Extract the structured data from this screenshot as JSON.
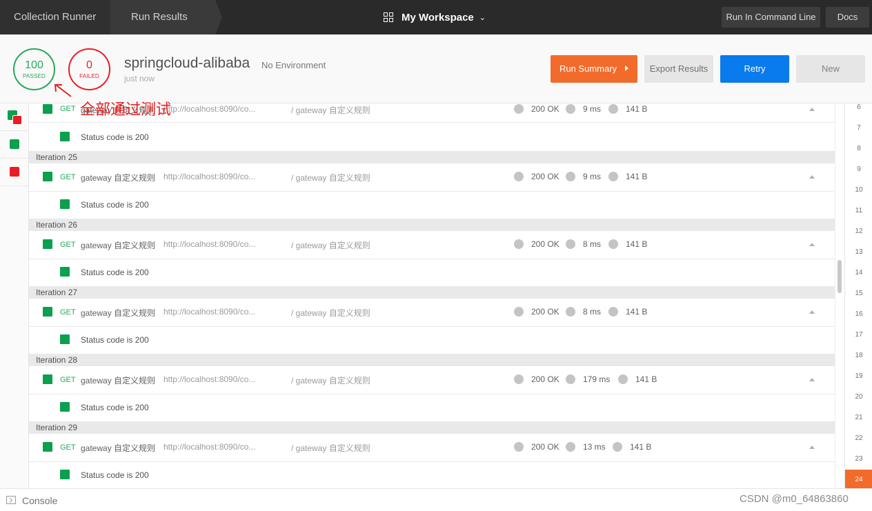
{
  "topbar": {
    "crumb1": "Collection Runner",
    "crumb2": "Run Results",
    "workspace": "My Workspace",
    "cmd_button": "Run In Command Line",
    "docs_button": "Docs"
  },
  "summary": {
    "passed_count": "100",
    "passed_label": "PASSED",
    "failed_count": "0",
    "failed_label": "FAILED",
    "collection_name": "springcloud-alibaba",
    "environment": "No Environment",
    "time": "just now",
    "buttons": {
      "run_summary": "Run Summary",
      "export": "Export Results",
      "retry": "Retry",
      "new": "New"
    }
  },
  "annotation": "全部通过测试",
  "rail": [
    {
      "status": "mixed"
    },
    {
      "status": "pass"
    },
    {
      "status": "fail"
    }
  ],
  "partial_row": {
    "method": "GET",
    "name": "gateway 自定义规则",
    "url": "http://localhost:8090/co...",
    "path": "/ gateway 自定义规则",
    "status": "200 OK",
    "time": "9 ms",
    "size": "141 B",
    "test": "Status code is 200"
  },
  "iterations": [
    {
      "label": "Iteration 25",
      "method": "GET",
      "name": "gateway 自定义规则",
      "url": "http://localhost:8090/co...",
      "path": "/ gateway 自定义规则",
      "status": "200 OK",
      "time": "9 ms",
      "size": "141 B",
      "test": "Status code is 200"
    },
    {
      "label": "Iteration 26",
      "method": "GET",
      "name": "gateway 自定义规则",
      "url": "http://localhost:8090/co...",
      "path": "/ gateway 自定义规则",
      "status": "200 OK",
      "time": "8 ms",
      "size": "141 B",
      "test": "Status code is 200"
    },
    {
      "label": "Iteration 27",
      "method": "GET",
      "name": "gateway 自定义规则",
      "url": "http://localhost:8090/co...",
      "path": "/ gateway 自定义规则",
      "status": "200 OK",
      "time": "8 ms",
      "size": "141 B",
      "test": "Status code is 200"
    },
    {
      "label": "Iteration 28",
      "method": "GET",
      "name": "gateway 自定义规则",
      "url": "http://localhost:8090/co...",
      "path": "/ gateway 自定义规则",
      "status": "200 OK",
      "time": "179 ms",
      "size": "141 B",
      "test": "Status code is 200"
    },
    {
      "label": "Iteration 29",
      "method": "GET",
      "name": "gateway 自定义规则",
      "url": "http://localhost:8090/co...",
      "path": "/ gateway 自定义规则",
      "status": "200 OK",
      "time": "13 ms",
      "size": "141 B",
      "test": "Status code is 200"
    }
  ],
  "iteration_numbers": [
    "6",
    "7",
    "8",
    "9",
    "10",
    "11",
    "12",
    "13",
    "14",
    "15",
    "16",
    "17",
    "18",
    "19",
    "20",
    "21",
    "22",
    "23",
    "24"
  ],
  "active_iteration": "24",
  "colors": {
    "pass": "#0ba050",
    "fail": "#ed1c24",
    "accent": "#f26b2b",
    "primary": "#097bed"
  },
  "footer": {
    "console": "Console",
    "watermark": "CSDN @m0_64863860"
  }
}
